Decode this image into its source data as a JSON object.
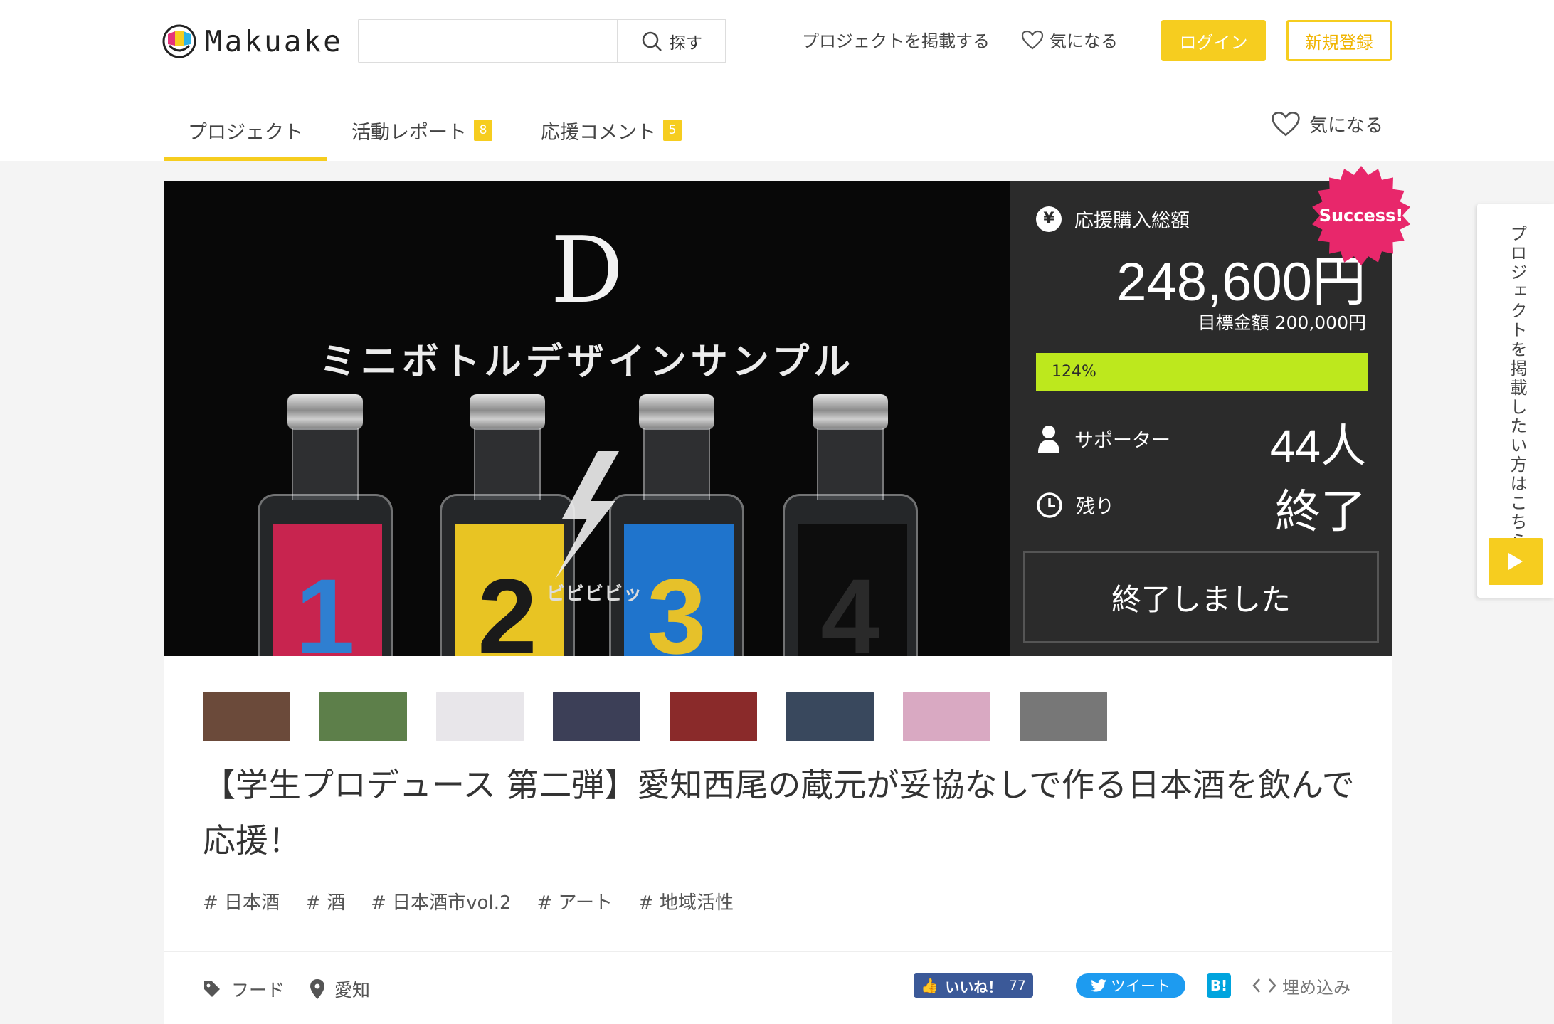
{
  "header": {
    "logo_text": "Makuake",
    "search": {
      "placeholder": "",
      "button_label": "探す"
    },
    "nav": {
      "post_project": "プロジェクトを掲載する",
      "favorite": "気になる"
    },
    "login": "ログイン",
    "register": "新規登録"
  },
  "tabs": [
    {
      "label": "プロジェクト",
      "badge": ""
    },
    {
      "label": "活動レポート",
      "badge": "8"
    },
    {
      "label": "応援コメント",
      "badge": "5"
    }
  ],
  "favorite_right": "気になる",
  "hero": {
    "letter": "D",
    "title": "ミニボトルデザインサンプル",
    "bottles": [
      {
        "num": "1",
        "label_color": "#c8244f",
        "num_color": "#2f7fd1"
      },
      {
        "num": "2",
        "label_color": "#e8c423",
        "num_color": "#1a1a1a"
      },
      {
        "num": "3",
        "label_color": "#1f74cc",
        "num_color": "#e6c12a"
      },
      {
        "num": "4",
        "label_color": "#0d0d0d",
        "num_color": "#2a2a2a"
      }
    ],
    "bibibi": "ビビビビッ"
  },
  "stats": {
    "amount_label": "応援購入総額",
    "amount": "248,600円",
    "goal": "目標金額 200,000円",
    "progress_text": "124%",
    "progress_percent": 124,
    "supporters_label": "サポーター",
    "supporters": "44人",
    "remaining_label": "残り",
    "remaining": "終了",
    "ended_button": "終了しました",
    "success_badge": "Success!",
    "accent_color": "#bde81d"
  },
  "thumbnails": [
    {
      "name": "thumb-1",
      "bg": "#6b4a3a"
    },
    {
      "name": "thumb-2",
      "bg": "#5d7f4a"
    },
    {
      "name": "thumb-3",
      "bg": "#e8e6ea"
    },
    {
      "name": "thumb-4",
      "bg": "#3c3f57"
    },
    {
      "name": "thumb-5",
      "bg": "#8a2a2a"
    },
    {
      "name": "thumb-6",
      "bg": "#39485d"
    },
    {
      "name": "thumb-7",
      "bg": "#d9a9c2"
    },
    {
      "name": "thumb-8",
      "bg": "#777777"
    }
  ],
  "project": {
    "title": "【学生プロデュース 第二弾】愛知西尾の蔵元が妥協なしで作る日本酒を飲んで応援！",
    "tags": [
      "# 日本酒",
      "# 酒",
      "# 日本酒市vol.2",
      "# アート",
      "# 地域活性"
    ],
    "category": "フード",
    "location": "愛知"
  },
  "share": {
    "like_label": "いいね！",
    "like_count": "77",
    "tweet_label": "ツイート",
    "hatena_label": "B!",
    "embed_label": "埋め込み"
  },
  "side_banner": {
    "text": "プロジェクトを掲載したい方はこちら"
  }
}
